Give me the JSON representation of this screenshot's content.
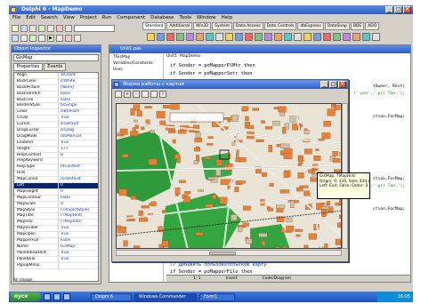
{
  "window": {
    "title": "Delphi 6 - MapDemo"
  },
  "menu": [
    "File",
    "Edit",
    "Search",
    "View",
    "Project",
    "Run",
    "Component",
    "Database",
    "Tools",
    "Window",
    "Help"
  ],
  "palette_tabs": [
    "Standard",
    "Additional",
    "Win32",
    "System",
    "Data Access",
    "Data Controls",
    "dbExpress",
    "DataSnap",
    "BDE",
    "ADO",
    "InterBase",
    "WebServices",
    "InternetExpress",
    "Internet",
    "WebSnap",
    "Decision Cube",
    "Dialogs",
    "Win 3.1",
    "Samples",
    "ActiveX",
    "COM+",
    "Indy Clients",
    "Indy Servers",
    "Indy Misc",
    "GIS Toolkit"
  ],
  "inspector": {
    "title": "Object Inspector",
    "object": "GisMap",
    "tabs": [
      "Properties",
      "Events"
    ],
    "properties": [
      {
        "name": "Align",
        "value": "alClient"
      },
      {
        "name": "BackColor",
        "value": "clWhite"
      },
      {
        "name": "BackPicture",
        "value": "(None)"
      },
      {
        "name": "BackStretch",
        "value": "False"
      },
      {
        "name": "BackTile",
        "value": "False"
      },
      {
        "name": "BorderStyle",
        "value": "bsSingle"
      },
      {
        "name": "Color",
        "value": "clBtnFace"
      },
      {
        "name": "Ctl3D",
        "value": "True"
      },
      {
        "name": "Cursor",
        "value": "crDefault"
      },
      {
        "name": "DragCursor",
        "value": "crDrag"
      },
      {
        "name": "DragMode",
        "value": "dmManual"
      },
      {
        "name": "Enabled",
        "value": "True"
      },
      {
        "name": "Height",
        "value": "177"
      },
      {
        "name": "HelpContext",
        "value": "0"
      },
      {
        "name": "HelpKeyword",
        "value": ""
      },
      {
        "name": "HelpType",
        "value": "htContext"
      },
      {
        "name": "Hint",
        "value": ""
      },
      {
        "name": "MapCursor",
        "value": "mcDefault"
      },
      {
        "name": "Left",
        "value": "0"
      },
      {
        "name": "MapHeight",
        "value": "0"
      },
      {
        "name": "MapContour",
        "value": "False"
      },
      {
        "name": "MapScale",
        "value": "0"
      },
      {
        "name": "MapStyle",
        "value": "(TProjectStyle)"
      },
      {
        "name": "MapTitle",
        "value": "(TMapHint)"
      },
      {
        "name": "MapInfo",
        "value": "(TMapInfo)"
      },
      {
        "name": "MapVisible",
        "value": "True"
      },
      {
        "name": "MapOpen",
        "value": "True"
      },
      {
        "name": "MapperFull",
        "value": "False"
      },
      {
        "name": "Name",
        "value": "GisMap"
      },
      {
        "name": "PanelShowHint",
        "value": "True"
      },
      {
        "name": "PanelDial",
        "value": "True"
      },
      {
        "name": "PopupMenu",
        "value": ""
      }
    ],
    "status": "All shown"
  },
  "editor": {
    "title": "Unit1.pas",
    "tree": [
      "TGisMap",
      "Variables/Constants",
      "Uses"
    ],
    "tabs": [
      "Unit1",
      "MapDemo"
    ],
    "code_lines": [
      "if Sender = poMapperPlMtr then",
      "if Sender = poMapperSetr then"
    ],
    "right_code": [
      "tOwner, Rect)",
      "('.pas','.pri Тап.');",
      "ction.FocMap;",
      "ction.FocMap;",
      "('.pas','.pri Тап.');",
      "ction.FocMap;"
    ],
    "comment": "// Добавить пользовательскую карту",
    "bottom_line": "if Sender = poMapperFile then",
    "status": [
      "1: 1",
      "Insert",
      "Code/Diagram"
    ]
  },
  "dialog": {
    "title": "Форма работы с картой",
    "tooltip_lines": [
      "GisMap: TMapHint",
      "Origin: 0, 335, Size: 434 x 244",
      "Left: Exit; False; Order: 0"
    ]
  },
  "taskbar": {
    "start": "пуск",
    "tasks": [
      "Delphi 6",
      "Windows Commander",
      "Form1"
    ],
    "tray": "16:05"
  }
}
